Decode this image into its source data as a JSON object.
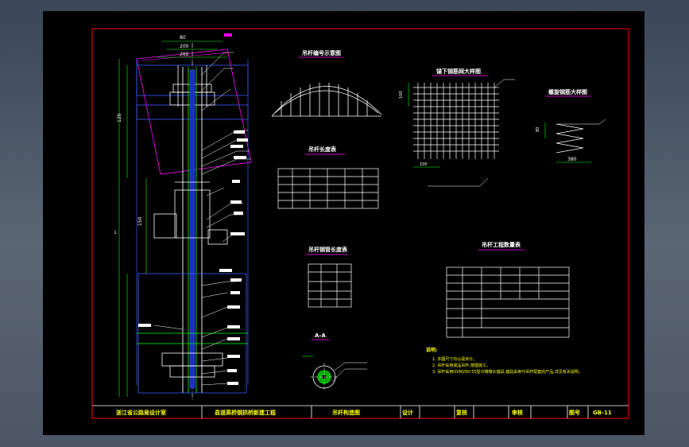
{
  "drawing": {
    "title_block": {
      "unit": "浙江省公路局设计室",
      "project": "县道高桥钢拱桥新建工程",
      "drawing_name": "吊杆构造图",
      "design_label": "设计",
      "review_label": "复核",
      "approve_label": "审核",
      "number_label": "图号",
      "number": "GB-11"
    },
    "views": {
      "hanger_layout": "吊杆编号示意图",
      "mesh_detail": "锚下钢筋网大样图",
      "spiral_detail": "螺旋钢筋大样图",
      "length_table": "吊杆长度表",
      "steel_table": "吊杆钢管长度表",
      "quantity_table": "吊杆工程数量表",
      "section": "A-A"
    },
    "notes": {
      "title": "说明:",
      "items": [
        "1. 本图尺寸均以毫米计。",
        "2. 吊杆采用成品吊杆,按图施工。",
        "3. 吊杆采用OVM250-55型冷铸镦头锚具,锚具采用与吊杆配套的产品,详见有关说明。"
      ]
    },
    "dims": {
      "top_a": "80",
      "top_b": "200",
      "top_c": "260",
      "mid_a": "120",
      "mid_b": "150",
      "spiral_w": "380",
      "spiral_h": "80",
      "length_L": "L",
      "mesh_a": "100",
      "mesh_b": "100"
    },
    "colors": {
      "background": "#000000",
      "border": "#ff0000",
      "line_white": "#ffffff",
      "line_blue": "#3c5cff",
      "line_green": "#00ff00",
      "line_magenta": "#ff00ff",
      "line_yellow": "#ffff00",
      "line_cyan": "#00ffff"
    }
  }
}
